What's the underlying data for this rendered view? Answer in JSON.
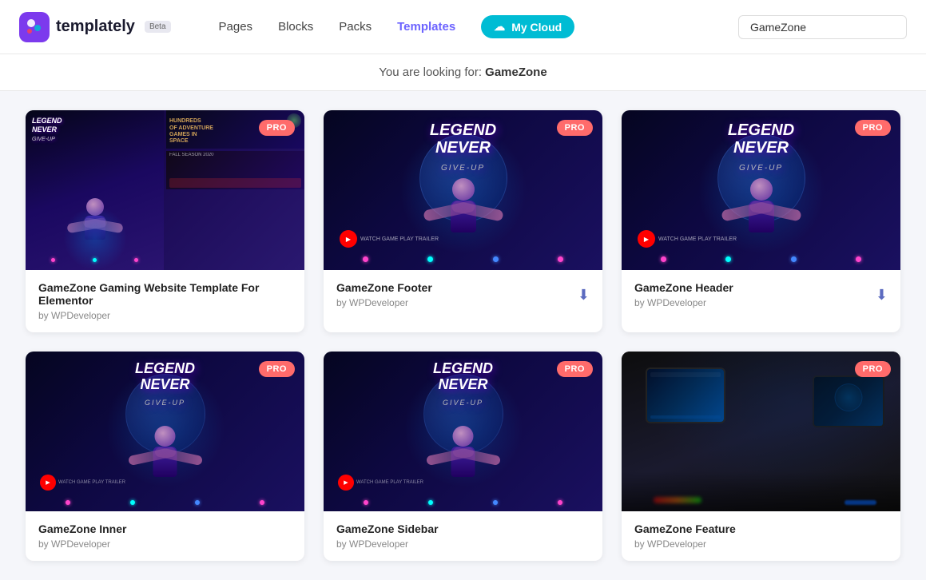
{
  "header": {
    "logo_text": "templately",
    "beta_label": "Beta",
    "nav": {
      "pages": "Pages",
      "blocks": "Blocks",
      "packs": "Packs",
      "templates": "Templates",
      "my_cloud": "My Cloud"
    },
    "search_value": "GameZone",
    "search_placeholder": "GameZone"
  },
  "search_banner": {
    "prefix": "You are looking for: ",
    "query": "GameZone"
  },
  "cards": [
    {
      "id": 1,
      "title": "GameZone Gaming Website Template For Elementor",
      "author": "by WPDeveloper",
      "pro": true,
      "pro_label": "PRO",
      "type": "multi-screen"
    },
    {
      "id": 2,
      "title": "GameZone Footer",
      "author": "by WPDeveloper",
      "pro": true,
      "pro_label": "PRO",
      "type": "gaming",
      "has_download": true
    },
    {
      "id": 3,
      "title": "GameZone Header",
      "author": "by WPDeveloper",
      "pro": true,
      "pro_label": "PRO",
      "type": "gaming",
      "has_download": true
    },
    {
      "id": 4,
      "title": "GameZone Inner",
      "author": "by WPDeveloper",
      "pro": true,
      "pro_label": "PRO",
      "type": "gaming2",
      "has_download": false
    },
    {
      "id": 5,
      "title": "GameZone Sidebar",
      "author": "by WPDeveloper",
      "pro": true,
      "pro_label": "PRO",
      "type": "gaming2",
      "has_download": false
    },
    {
      "id": 6,
      "title": "GameZone Feature",
      "author": "by WPDeveloper",
      "pro": true,
      "pro_label": "PRO",
      "type": "photo",
      "has_download": false
    }
  ],
  "download_icon": "⬇",
  "play_label": "WATCH GAME PLAY TRAILER"
}
